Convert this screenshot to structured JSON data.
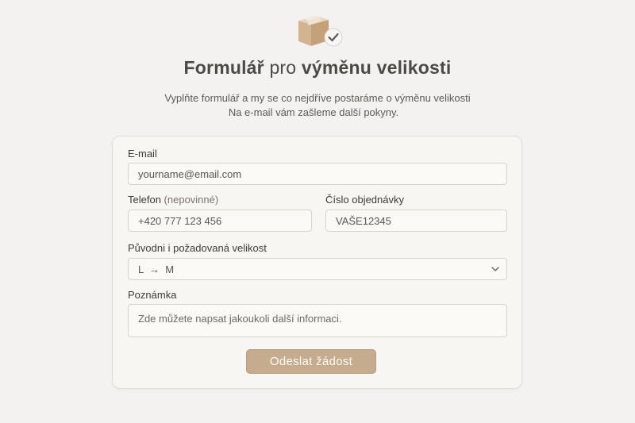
{
  "header": {
    "icon": "package-check-icon",
    "title_part1": "Formulář",
    "title_part2": "pro",
    "title_part3": "výměnu velikosti",
    "subtitle_line1": "Vyplňte formulář a my se co nejdříve postaráme o výměnu velikosti",
    "subtitle_line2": "Na e-mail vám zašleme další pokyny."
  },
  "form": {
    "email": {
      "label": "E-mail",
      "placeholder": "yourname@email.com"
    },
    "phone": {
      "label": "Telefon",
      "hint": "(nepovinné)",
      "placeholder": "+420 777 123 456"
    },
    "order": {
      "label": "Číslo objednávky",
      "placeholder": "VAŠE12345"
    },
    "size": {
      "label": "Původni i požadovaná velikost",
      "value": "L  →  M",
      "icon": "chevron-down-icon"
    },
    "note": {
      "label": "Poznámka",
      "placeholder": "Zde můžete napsat jakoukoli další informaci."
    },
    "submit_label": "Odeslat žádost"
  },
  "colors": {
    "accent": "#c5ac8f",
    "background": "#f3f2f0",
    "card": "#f8f6f2"
  }
}
